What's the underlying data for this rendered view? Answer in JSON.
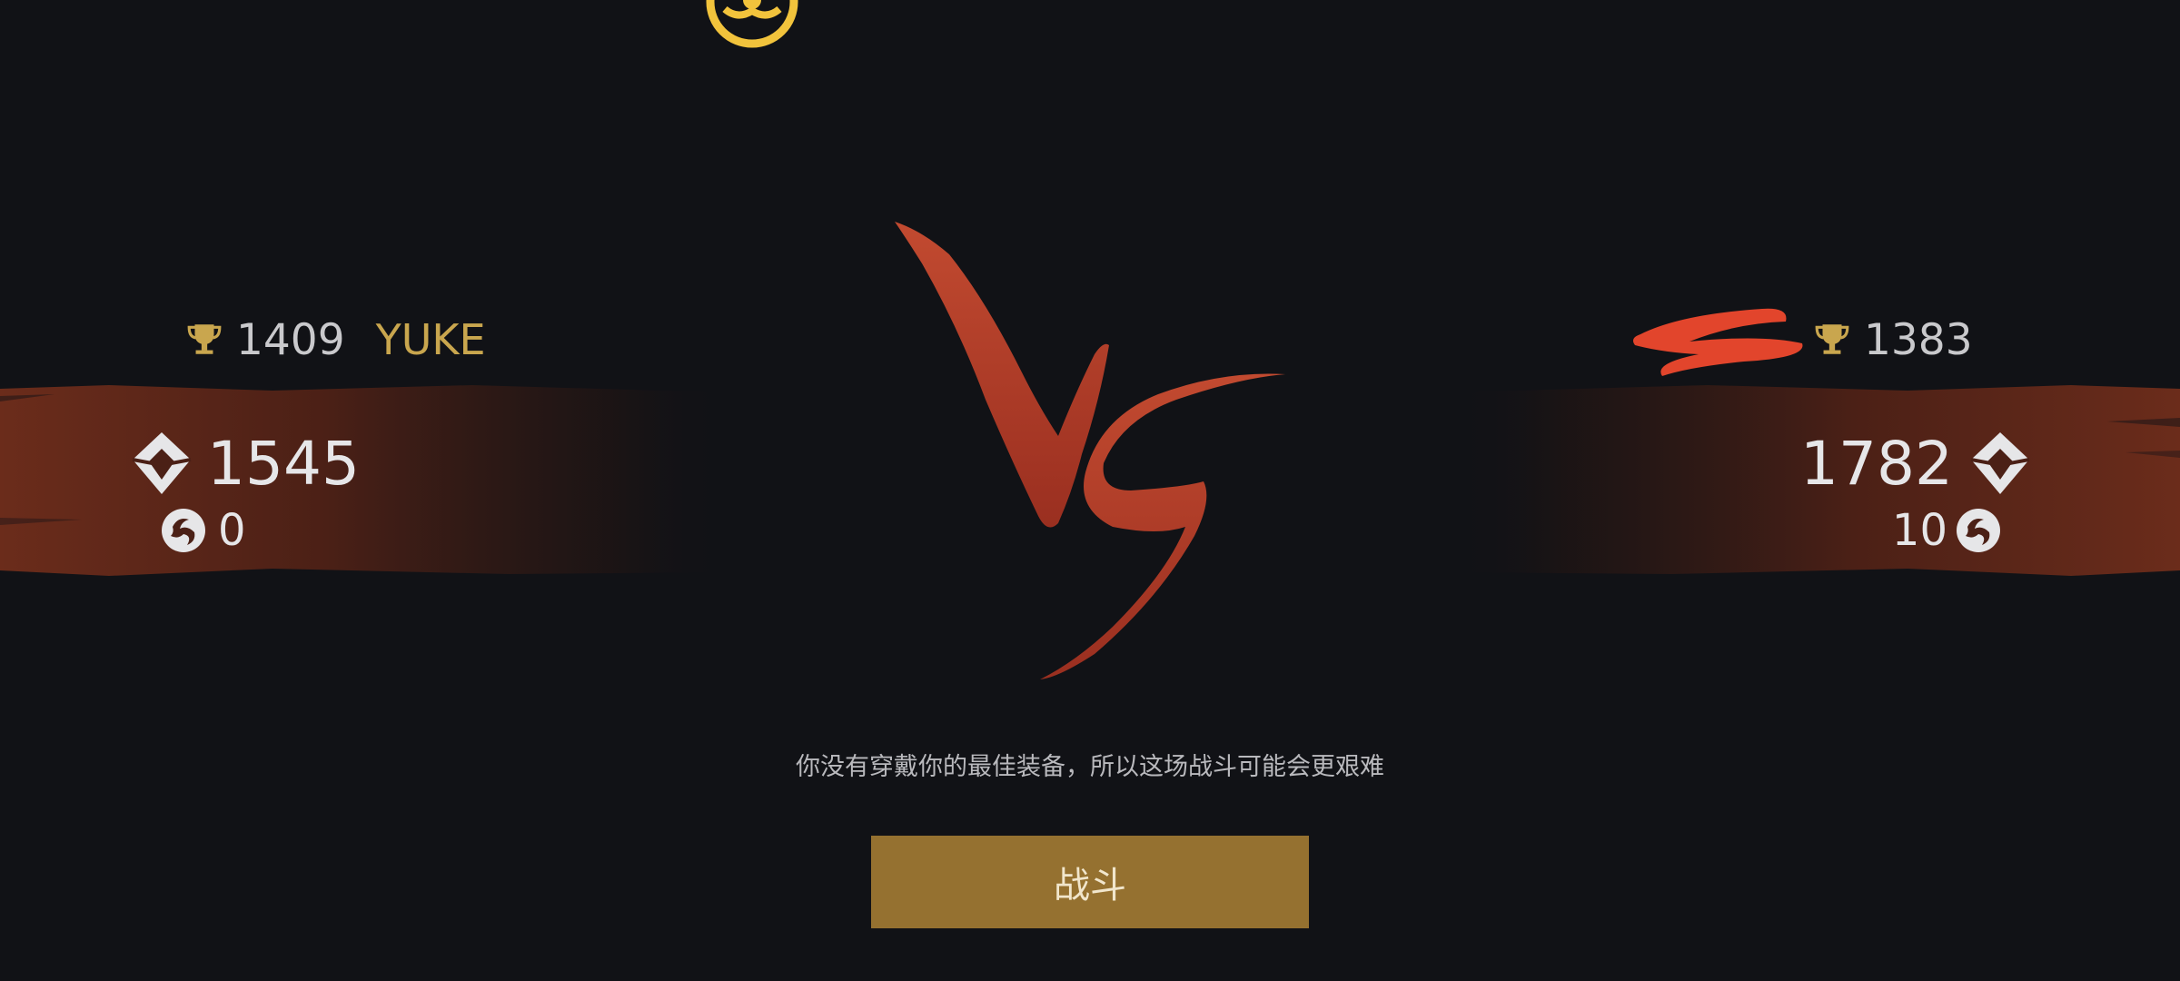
{
  "colors": {
    "background": "#111216",
    "gold": "#c9a64e",
    "band": "#5a2618",
    "vs": "#c0432c",
    "button": "#957130",
    "text_light": "#e6e6e8",
    "text_muted": "#b9b9bd",
    "redaction": "#e2452c"
  },
  "icons": {
    "trophy": "trophy-icon",
    "rating": "diamond-rank-icon",
    "streak": "swirl-icon",
    "emblem": "gold-emblem-icon",
    "vs": "vs-brush-mark"
  },
  "player": {
    "trophies": "1409",
    "name": "YUKE",
    "rating": "1545",
    "streak": "0"
  },
  "opponent": {
    "trophies": "1383",
    "name_redacted": true,
    "rating": "1782",
    "streak": "10"
  },
  "warning": "你没有穿戴你的最佳装备，所以这场战斗可能会更艰难",
  "fight_button": "战斗"
}
